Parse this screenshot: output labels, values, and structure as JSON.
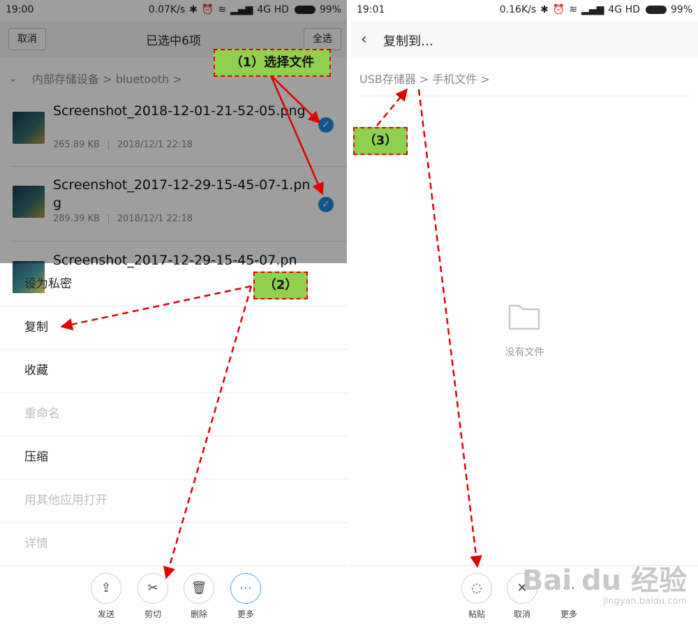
{
  "left": {
    "status": {
      "time": "19:00",
      "speed": "0.07K/s",
      "network": "4G HD",
      "battery": "99%"
    },
    "topbar": {
      "cancel": "取消",
      "title": "已选中6项",
      "select_all": "全选"
    },
    "breadcrumb": {
      "path": "内部存储设备 > bluetooth >"
    },
    "files": [
      {
        "name": "Screenshot_2018-12-01-21-52-05.png",
        "size": "265.89 KB",
        "date": "2018/12/1 22:18"
      },
      {
        "name": "Screenshot_2017-12-29-15-45-07-1.png",
        "size": "289.39 KB",
        "date": "2018/12/1 22:18"
      },
      {
        "name": "Screenshot_2017-12-29-15-45-07.pn",
        "size": "",
        "date": ""
      }
    ],
    "menu": [
      {
        "label": "设为私密",
        "enabled": true
      },
      {
        "label": "复制",
        "enabled": true
      },
      {
        "label": "收藏",
        "enabled": true
      },
      {
        "label": "重命名",
        "enabled": false
      },
      {
        "label": "压缩",
        "enabled": true
      },
      {
        "label": "用其他应用打开",
        "enabled": false
      },
      {
        "label": "详情",
        "enabled": false
      }
    ],
    "actions": [
      {
        "label": "发送",
        "icon": "share-icon"
      },
      {
        "label": "剪切",
        "icon": "scissors-icon"
      },
      {
        "label": "删除",
        "icon": "trash-icon"
      },
      {
        "label": "更多",
        "icon": "more-icon"
      }
    ]
  },
  "right": {
    "status": {
      "time": "19:01",
      "speed": "0.16K/s",
      "network": "4G HD",
      "battery": "99%"
    },
    "title": "复制到…",
    "breadcrumb": "USB存储器 > 手机文件 >",
    "empty": "没有文件",
    "actions": [
      {
        "label": "粘贴",
        "icon": "paste-icon"
      },
      {
        "label": "取消",
        "icon": "close-icon"
      },
      {
        "label": "更多",
        "icon": "more-icon"
      }
    ]
  },
  "annotations": {
    "step1": "（1）选择文件",
    "step2": "（2）",
    "step3": "（3）"
  },
  "watermark": {
    "line1": "Bai du 经验",
    "line2": "jingyan.baidu.com"
  },
  "colors": {
    "accent": "#1e88e5",
    "annotation_fill": "#8fd14f",
    "annotation_arrow": "#e00000"
  }
}
